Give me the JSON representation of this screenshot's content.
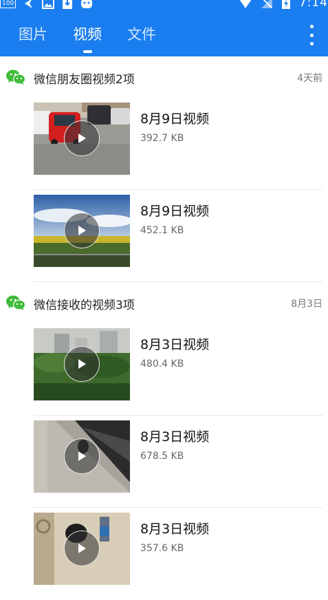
{
  "status_bar": {
    "battery_level": "100",
    "time": "7:14"
  },
  "tabs": [
    {
      "label": "图片",
      "active": false
    },
    {
      "label": "视频",
      "active": true
    },
    {
      "label": "文件",
      "active": false
    }
  ],
  "colors": {
    "accent": "#1a7ef0",
    "wechat_green": "#3fbc3a"
  },
  "groups": [
    {
      "icon": "wechat-icon",
      "title": "微信朋友圈视频2项",
      "date": "4天前",
      "items": [
        {
          "title": "8月9日视频",
          "size": "392.7 KB"
        },
        {
          "title": "8月9日视频",
          "size": "452.1 KB"
        }
      ]
    },
    {
      "icon": "wechat-icon",
      "title": "微信接收的视频3项",
      "date": "8月3日",
      "items": [
        {
          "title": "8月3日视频",
          "size": "480.4 KB"
        },
        {
          "title": "8月3日视频",
          "size": "678.5 KB"
        },
        {
          "title": "8月3日视频",
          "size": "357.6 KB"
        }
      ]
    }
  ]
}
